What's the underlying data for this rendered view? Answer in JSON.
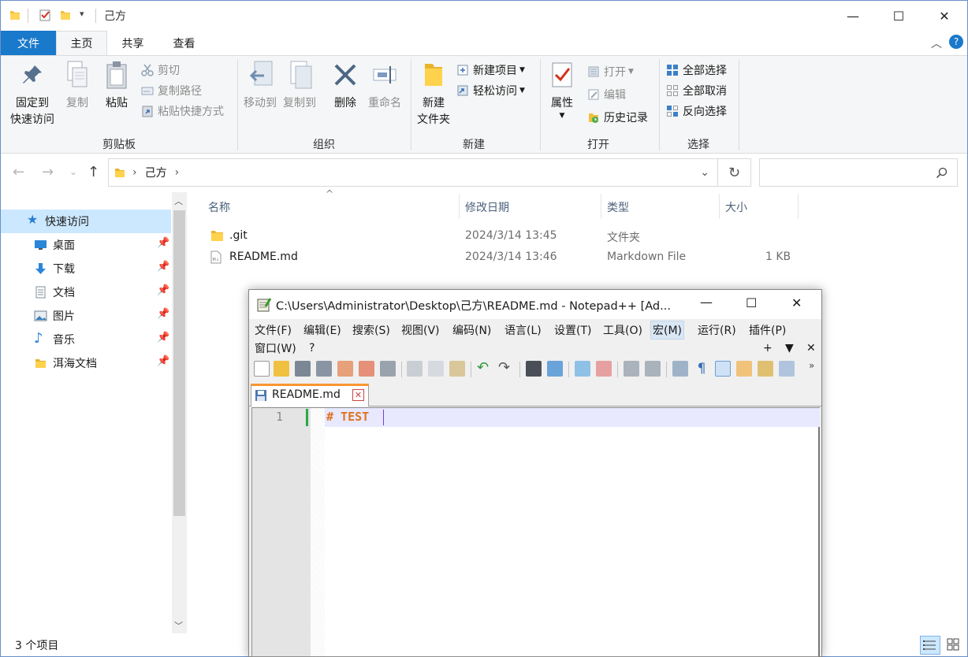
{
  "explorer": {
    "title": "己方",
    "window_controls": {
      "minimize": "—",
      "maximize": "☐",
      "close": "✕"
    },
    "tabs": {
      "file": "文件",
      "home": "主页",
      "share": "共享",
      "view": "查看"
    },
    "ribbon": {
      "clipboard": {
        "pin_label_1": "固定到",
        "pin_label_2": "快速访问",
        "copy": "复制",
        "paste": "粘贴",
        "cut": "剪切",
        "copy_path": "复制路径",
        "paste_shortcut": "粘贴快捷方式",
        "group": "剪贴板"
      },
      "organize": {
        "move_to": "移动到",
        "copy_to": "复制到",
        "delete": "删除",
        "rename": "重命名",
        "group": "组织"
      },
      "new": {
        "new_folder_1": "新建",
        "new_folder_2": "文件夹",
        "new_item": "新建项目",
        "easy_access": "轻松访问",
        "group": "新建"
      },
      "open": {
        "properties": "属性",
        "open": "打开",
        "edit": "编辑",
        "history": "历史记录",
        "group": "打开"
      },
      "select": {
        "select_all": "全部选择",
        "select_none": "全部取消",
        "invert": "反向选择",
        "group": "选择"
      }
    },
    "address": {
      "path": "己方"
    },
    "nav": {
      "quick_access": "快速访问",
      "items": [
        {
          "label": "桌面"
        },
        {
          "label": "下载"
        },
        {
          "label": "文档"
        },
        {
          "label": "图片"
        },
        {
          "label": "音乐"
        },
        {
          "label": "洱海文档"
        }
      ]
    },
    "columns": {
      "name": "名称",
      "modified": "修改日期",
      "type": "类型",
      "size": "大小"
    },
    "files": [
      {
        "name": ".git",
        "modified": "2024/3/14 13:45",
        "type": "文件夹",
        "size": ""
      },
      {
        "name": "README.md",
        "modified": "2024/3/14 13:46",
        "type": "Markdown File",
        "size": "1 KB"
      }
    ],
    "status": "3 个项目"
  },
  "notepad": {
    "title": "C:\\Users\\Administrator\\Desktop\\己方\\README.md - Notepad++ [Ad...",
    "menu": [
      "文件(F)",
      "编辑(E)",
      "搜索(S)",
      "视图(V)",
      "编码(N)",
      "语言(L)",
      "设置(T)",
      "工具(O)",
      "宏(M)",
      "运行(R)",
      "插件(P)",
      "窗口(W)",
      "?"
    ],
    "menu_right": {
      "plus": "+",
      "down": "▼",
      "close": "✕"
    },
    "tab_label": "README.md",
    "line_number": "1",
    "line_text": "# TEST",
    "colors": {
      "accent_orange": "#fa9631",
      "markdown_heading": "#e0731f",
      "current_line": "#e8e8ff"
    }
  }
}
